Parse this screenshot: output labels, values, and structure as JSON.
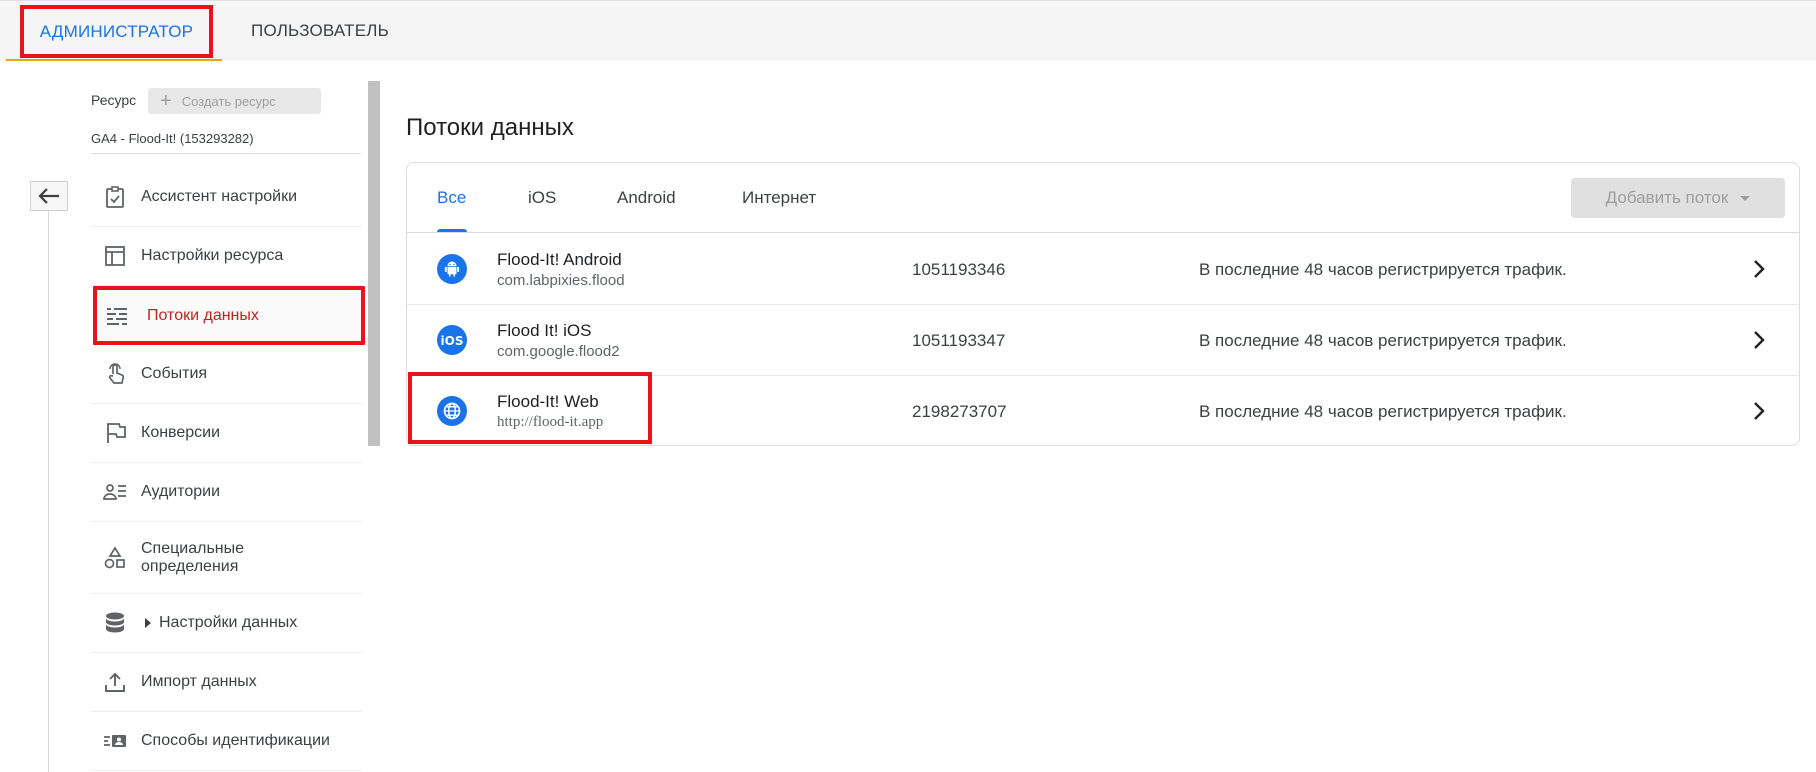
{
  "top_tabs": {
    "admin_label": "АДМИНИСТРАТОР",
    "user_label": "ПОЛЬЗОВАТЕЛЬ"
  },
  "property": {
    "label": "Ресурс",
    "create_label": "Создать ресурс",
    "name": "GA4 - Flood-It! (153293282)"
  },
  "sidebar": {
    "items": [
      {
        "label": "Ассистент настройки",
        "icon": "clipboard-check-icon"
      },
      {
        "label": "Настройки ресурса",
        "icon": "layout-icon"
      },
      {
        "label": "Потоки данных",
        "icon": "data-streams-icon",
        "active": true
      },
      {
        "label": "События",
        "icon": "touch-icon"
      },
      {
        "label": "Конверсии",
        "icon": "flag-icon"
      },
      {
        "label": "Аудитории",
        "icon": "audience-icon"
      },
      {
        "label": "Специальные определения",
        "icon": "shapes-icon"
      },
      {
        "label": "Настройки данных",
        "icon": "database-icon"
      },
      {
        "label": "Импорт данных",
        "icon": "upload-icon"
      },
      {
        "label": "Способы идентификации",
        "icon": "identity-icon"
      }
    ]
  },
  "main": {
    "title": "Потоки данных",
    "tabs": [
      "Все",
      "iOS",
      "Android",
      "Интернет"
    ],
    "add_stream_label": "Добавить поток",
    "streams": [
      {
        "name": "Flood-It! Android",
        "sub": "com.labpixies.flood",
        "id": "1051193346",
        "status": "В последние 48 часов регистрируется трафик.",
        "icon": "android-icon"
      },
      {
        "name": "Flood It! iOS",
        "sub": "com.google.flood2",
        "id": "1051193347",
        "status": "В последние 48 часов регистрируется трафик.",
        "icon": "ios-icon"
      },
      {
        "name": "Flood-It! Web",
        "sub": "http://flood-it.app",
        "id": "2198273707",
        "status": "В последние 48 часов регистрируется трафик.",
        "icon": "globe-icon"
      }
    ]
  },
  "colors": {
    "accent": "#1a73e8",
    "highlight": "#e8141b",
    "active_text": "#c5221f"
  }
}
